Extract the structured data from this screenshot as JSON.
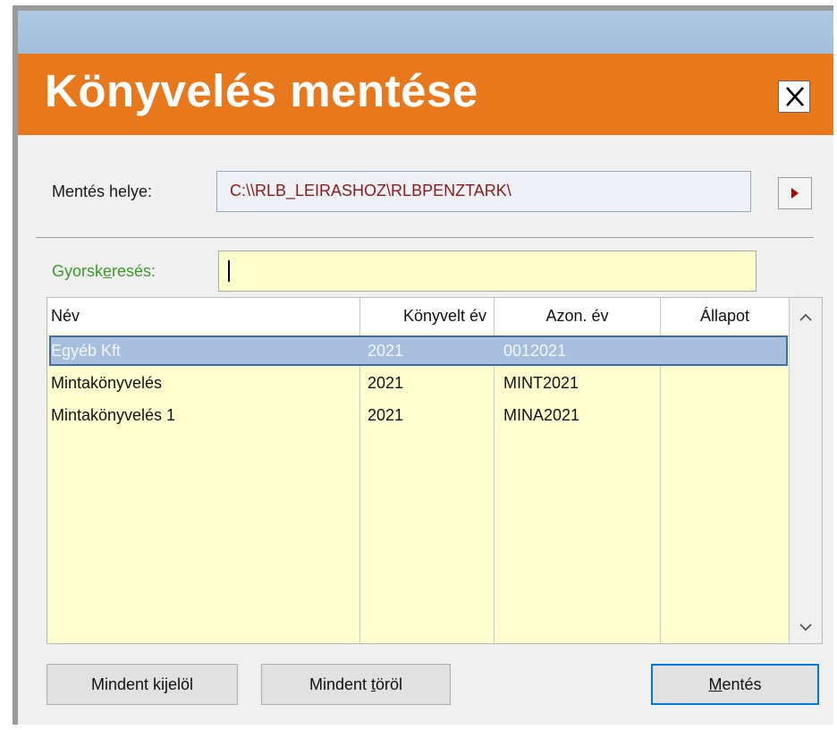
{
  "dialog": {
    "title": "Könyvelés mentése",
    "close_glyph": "X"
  },
  "location": {
    "label": "Mentés helye:",
    "path": "C:\\\\RLB_LEIRASHOZ\\RLBPENZTARK\\"
  },
  "search": {
    "label_pre": "Gyorsk",
    "label_hot": "e",
    "label_post": "resés:",
    "value": ""
  },
  "table": {
    "columns": [
      "Név",
      "Könyvelt év",
      "Azon. év",
      "Állapot"
    ],
    "rows": [
      {
        "name": "Egyéb Kft",
        "year": "2021",
        "id_year": "0012021",
        "status": "",
        "selected": true
      },
      {
        "name": "Mintakönyvelés",
        "year": "2021",
        "id_year": "MINT2021",
        "status": "",
        "selected": false
      },
      {
        "name": "Mintakönyvelés 1",
        "year": "2021",
        "id_year": "MINA2021",
        "status": "",
        "selected": false
      }
    ]
  },
  "buttons": {
    "select_all": {
      "pre": "Mindent ki",
      "hot": "j",
      "post": "elöl"
    },
    "clear_all": {
      "pre": "Mindent ",
      "hot": "t",
      "post": "öröl"
    },
    "save": {
      "pre": "",
      "hot": "M",
      "post": "entés"
    }
  },
  "icons": {
    "close": "close-icon",
    "browse": "triangle-right-icon",
    "scroll_up": "chevron-up-icon",
    "scroll_down": "chevron-down-icon"
  },
  "colors": {
    "title_bar": "#e8781c",
    "top_strip": "#a3bedb",
    "path_text": "#8b1a1a",
    "search_label": "#3a9a2a",
    "grid_body": "#ffffd0",
    "selected_row": "#a7bfdd",
    "primary_border": "#0078d7"
  }
}
